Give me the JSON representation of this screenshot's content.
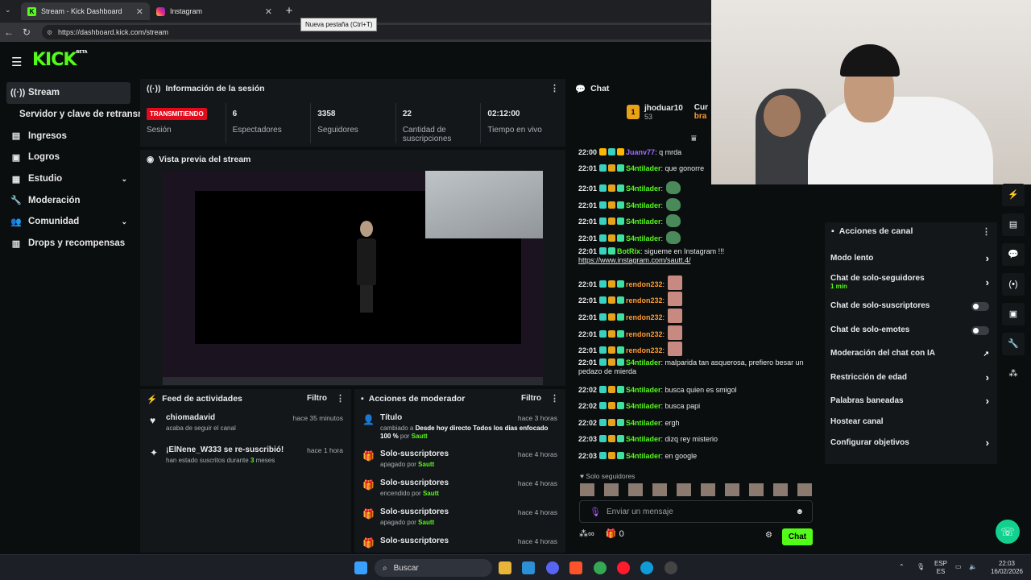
{
  "browser": {
    "tabs": [
      {
        "title": "Stream - Kick Dashboard",
        "active": true
      },
      {
        "title": "Instagram",
        "active": false
      }
    ],
    "new_tab_tooltip": "Nueva pestaña (Ctrl+T)",
    "url": "https://dashboard.kick.com/stream"
  },
  "brand": {
    "logo": "KICK",
    "beta": "BETA",
    "accent": "#53fc18"
  },
  "sidebar": {
    "items": [
      {
        "label": "Stream",
        "icon": "broadcast-icon",
        "active": true
      },
      {
        "label": "Servidor y clave de retransmisión",
        "sub": true
      },
      {
        "label": "Ingresos",
        "icon": "income-icon"
      },
      {
        "label": "Logros",
        "icon": "trophy-icon"
      },
      {
        "label": "Estudio",
        "icon": "studio-icon",
        "expand": true
      },
      {
        "label": "Moderación",
        "icon": "wrench-icon"
      },
      {
        "label": "Comunidad",
        "icon": "community-icon",
        "expand": true
      },
      {
        "label": "Drops y recompensas",
        "icon": "drops-icon"
      }
    ]
  },
  "session": {
    "title": "Información de la sesión",
    "status": "TRANSMITIENDO",
    "stats": [
      {
        "value": "",
        "label": "Sesión"
      },
      {
        "value": "6",
        "label": "Espectadores"
      },
      {
        "value": "3358",
        "label": "Seguidores"
      },
      {
        "value": "22",
        "label": "Cantidad de suscripciones"
      },
      {
        "value": "02:12:00",
        "label": "Tiempo en vivo"
      }
    ]
  },
  "preview": {
    "title": "Vista previa del stream"
  },
  "feed": {
    "title": "Feed de actividades",
    "filter": "Filtro",
    "items": [
      {
        "name": "chiomadavid",
        "desc": "acaba de seguir el canal",
        "time": "hace 35 minutos",
        "icon": "heart-icon"
      },
      {
        "name": "¡ElNene_W333 se re-suscribió!",
        "desc_a": "han estado suscritos durante ",
        "desc_b": "3",
        "desc_c": " meses",
        "time": "hace 1 hora",
        "icon": "sparkle-icon"
      }
    ]
  },
  "modactions": {
    "title": "Acciones de moderador",
    "filter": "Filtro",
    "items": [
      {
        "title": "Título",
        "time": "hace 3 horas",
        "a": "cambiado a ",
        "b": "Desde hoy directo Todos los dias enfocado 100 %",
        "c": " por ",
        "d": "Sautt",
        "icon": "user-edit-icon"
      },
      {
        "title": "Solo-suscriptores",
        "time": "hace 4 horas",
        "a": "apagado por ",
        "d": "Sautt",
        "icon": "gift-icon"
      },
      {
        "title": "Solo-suscriptores",
        "time": "hace 4 horas",
        "a": "encendido por ",
        "d": "Sautt",
        "icon": "gift-icon"
      },
      {
        "title": "Solo-suscriptores",
        "time": "hace 4 horas",
        "a": "apagado por ",
        "d": "Sautt",
        "icon": "gift-icon"
      },
      {
        "title": "Solo-suscriptores",
        "time": "hace 4 horas",
        "a": "",
        "d": "",
        "icon": "gift-icon"
      }
    ]
  },
  "chat": {
    "title": "Chat",
    "pinned": {
      "user": "jhoduar10",
      "count": "53",
      "rank": "1",
      "extra_a": "Cur",
      "extra_b": "bra"
    },
    "messages": [
      {
        "time": "22:00",
        "user": "Juanv77",
        "text": ": q mrda",
        "color": "p"
      },
      {
        "time": "22:01",
        "user": "S4ntilader",
        "text": ": que gonorre"
      },
      {
        "time": "22:01",
        "user": "S4ntilader",
        "text": ":",
        "emote": true
      },
      {
        "time": "22:01",
        "user": "S4ntilader",
        "text": ":",
        "emote": true
      },
      {
        "time": "22:01",
        "user": "S4ntilader",
        "text": ":",
        "emote": true
      },
      {
        "time": "22:01",
        "user": "S4ntilader",
        "text": ":",
        "emote": true
      },
      {
        "time": "22:01",
        "user": "BotRix",
        "text": ": sigueme en Instagram !!!",
        "link": "https://www.instagram.com/sautt.4/"
      },
      {
        "time": "22:01",
        "user": "rendon232",
        "text": ":",
        "color": "o",
        "face": true
      },
      {
        "time": "22:01",
        "user": "rendon232",
        "text": ":",
        "color": "o",
        "face": true
      },
      {
        "time": "22:01",
        "user": "rendon232",
        "text": ":",
        "color": "o",
        "face": true
      },
      {
        "time": "22:01",
        "user": "rendon232",
        "text": ":",
        "color": "o",
        "face": true
      },
      {
        "time": "22:01",
        "user": "rendon232",
        "text": ":",
        "color": "o",
        "face": true
      },
      {
        "time": "22:01",
        "user": "S4ntilader",
        "text": ": malparida tan asquerosa, prefiero besar un pedazo de mierda"
      },
      {
        "time": "22:02",
        "user": "S4ntilader",
        "text": ": busca quien es smigol"
      },
      {
        "time": "22:02",
        "user": "S4ntilader",
        "text": ": busca papi"
      },
      {
        "time": "22:02",
        "user": "S4ntilader",
        "text": ": ergh"
      },
      {
        "time": "22:03",
        "user": "S4ntilader",
        "text": ": dizq rey misterio"
      },
      {
        "time": "22:03",
        "user": "S4ntilader",
        "text": ": en google"
      }
    ],
    "followers_only": "Solo seguidores",
    "input_placeholder": "Enviar un mensaje",
    "send_label": "Chat",
    "infinity": "∞",
    "gift_count": "0"
  },
  "channel_actions": {
    "title": "Acciones de canal",
    "items": [
      {
        "label": "Modo lento",
        "type": "arrow"
      },
      {
        "label": "Chat de solo-seguidores",
        "sub": "1 min",
        "type": "arrow"
      },
      {
        "label": "Chat de solo-suscriptores",
        "type": "toggle"
      },
      {
        "label": "Chat de solo-emotes",
        "type": "toggle"
      },
      {
        "label": "Moderación del chat con IA",
        "type": "external"
      },
      {
        "label": "Restricción de edad",
        "type": "arrow"
      },
      {
        "label": "Palabras baneadas",
        "type": "arrow"
      },
      {
        "label": "Hostear canal",
        "type": "none"
      },
      {
        "label": "Configurar objetivos",
        "type": "arrow"
      }
    ]
  },
  "taskbar": {
    "search": "Buscar",
    "lang_a": "ESP",
    "lang_b": "ES",
    "time": "22:03",
    "date": "16/02/2026"
  }
}
